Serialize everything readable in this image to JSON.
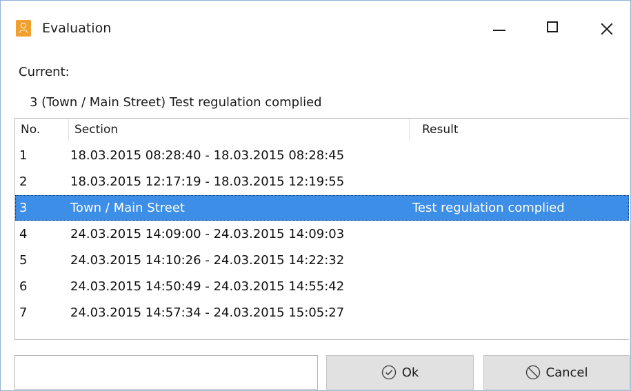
{
  "window": {
    "title": "Evaluation",
    "app_icon": "evaluation-app-icon",
    "controls": {
      "minimize_icon": "minimize-icon",
      "maximize_icon": "maximize-icon",
      "close_icon": "close-icon"
    }
  },
  "current": {
    "label": "Current:",
    "value": "3 (Town / Main Street) Test regulation complied"
  },
  "table": {
    "headers": {
      "no": "No.",
      "section": "Section",
      "result": "Result"
    },
    "rows": [
      {
        "no": "1",
        "section": "18.03.2015 08:28:40 - 18.03.2015 08:28:45",
        "result": ""
      },
      {
        "no": "2",
        "section": "18.03.2015 12:17:19 - 18.03.2015 12:19:55",
        "result": ""
      },
      {
        "no": "3",
        "section": "Town / Main Street",
        "result": "Test regulation complied"
      },
      {
        "no": "4",
        "section": "24.03.2015 14:09:00 - 24.03.2015 14:09:03",
        "result": ""
      },
      {
        "no": "5",
        "section": "24.03.2015 14:10:26 - 24.03.2015 14:22:32",
        "result": ""
      },
      {
        "no": "6",
        "section": "24.03.2015 14:50:49 - 24.03.2015 14:55:42",
        "result": ""
      },
      {
        "no": "7",
        "section": "24.03.2015 14:57:34 - 24.03.2015 15:05:27",
        "result": ""
      }
    ],
    "selected_row": "3",
    "selection_color": "#3d8ee6"
  },
  "footer": {
    "input_value": "",
    "ok_label": "Ok",
    "cancel_label": "Cancel",
    "ok_icon": "check-circle-icon",
    "cancel_icon": "ban-circle-icon"
  }
}
